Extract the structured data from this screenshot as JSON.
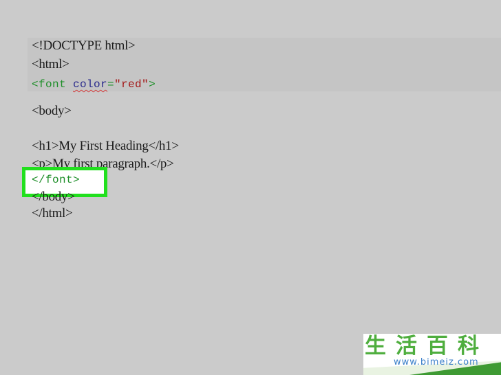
{
  "code_lines": {
    "doctype": "<!DOCTYPE html>",
    "html_open": "<html>",
    "font_tag_open_start": "<font ",
    "font_attr": "color",
    "font_equals": "=",
    "font_value": "\"red\"",
    "font_tag_open_end": ">",
    "body_open": "<body>",
    "h1_line": "<h1>My First Heading</h1>",
    "p_line": "<p>My first paragraph.</p>",
    "font_close": "</font>",
    "body_close": "</body>",
    "html_close": "</html>"
  },
  "watermark": {
    "chars": "生活百科",
    "url": "www.bimeiz.com"
  },
  "colors": {
    "background": "#cbcbcb",
    "highlight_border": "#22e01e",
    "tag_green": "#1f8f2a",
    "string_red": "#a31515"
  }
}
